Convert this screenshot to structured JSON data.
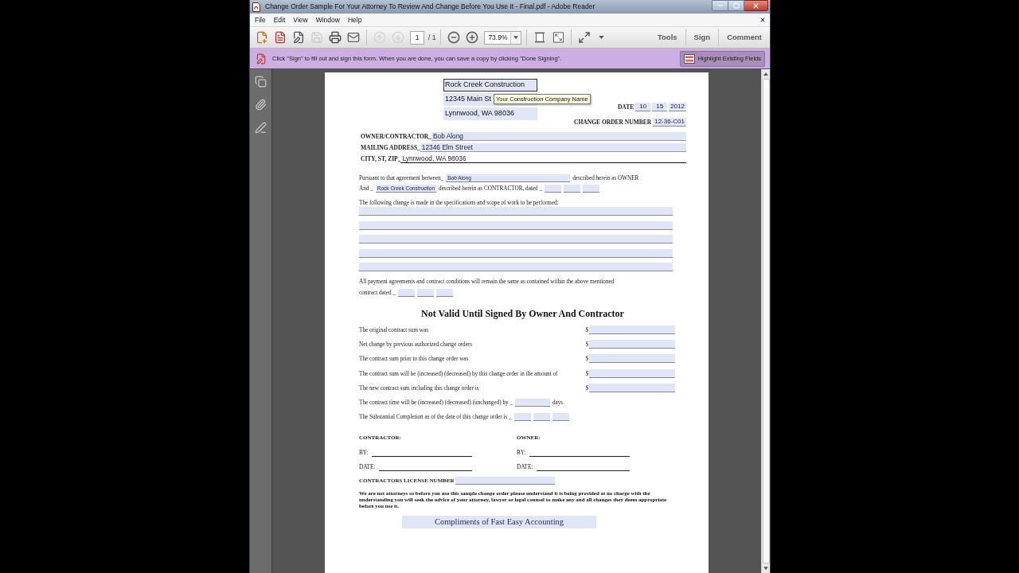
{
  "window": {
    "title": "Change Order Sample For Your Attorney To Review And Change Before You Use It - Final.pdf - Adobe Reader"
  },
  "menu": [
    {
      "label": "File"
    },
    {
      "label": "Edit"
    },
    {
      "label": "View"
    },
    {
      "label": "Window"
    },
    {
      "label": "Help"
    }
  ],
  "toolbar": {
    "file_tools": [
      {
        "kind": "create",
        "disabled": false
      },
      {
        "kind": "convert",
        "disabled": false
      },
      {
        "kind": "edit",
        "disabled": false
      },
      {
        "kind": "save",
        "disabled": true
      },
      {
        "kind": "print",
        "disabled": false
      },
      {
        "kind": "email",
        "disabled": false
      }
    ],
    "page_tools": [
      {
        "kind": "previous",
        "disabled": true
      },
      {
        "kind": "next",
        "disabled": true
      }
    ],
    "page": "1",
    "page_total": "/ 1",
    "zoom_tools": [
      {
        "kind": "zoom_out"
      },
      {
        "kind": "zoom_in"
      }
    ],
    "zoom": "73.9%",
    "view_tools": [
      {
        "kind": "scrolling"
      },
      {
        "kind": "fit"
      }
    ],
    "extra_tools": [
      {
        "kind": "full_screen"
      },
      {
        "kind": "more"
      }
    ],
    "panels": [
      {
        "label": "Tools"
      },
      {
        "label": "Sign"
      },
      {
        "label": "Comment"
      }
    ]
  },
  "message_bar": {
    "text": "Click \"Sign\" to fill out and sign this form. When you are done, you can save a copy by clicking \"Done Signing\".",
    "button": "Highlight Existing Fields"
  },
  "document": {
    "company_fields": [
      {
        "value": "Rock Creek Construction",
        "focused": true
      },
      {
        "value": "12345 Main St",
        "focused": false
      },
      {
        "value": "Lynnwood, WA 98036",
        "focused": false
      }
    ],
    "tooltip": "Your Construction Company Name",
    "date": {
      "label": "DATE",
      "fields": [
        {
          "value": "10"
        },
        {
          "value": "15"
        },
        {
          "value": "2012"
        }
      ]
    },
    "change_order": {
      "label": "CHANGE ORDER NUMBER",
      "value": "12-36-C01"
    },
    "parties": [
      {
        "label": "OWNER/CONTRACTOR_",
        "value": "Bob Along",
        "highlighted": true
      },
      {
        "label": "MAILING ADDRESS_",
        "value": "12346 Elm Street",
        "highlighted": true
      },
      {
        "label": "CITY, ST, ZIP_",
        "value": "Lynnwood, WA 98036",
        "highlighted": false
      }
    ],
    "agreement_lines": [
      {
        "segments": [
          {
            "kind": "text",
            "text": "Pursuant to that agreement between_"
          },
          {
            "kind": "wide_field",
            "value": "Bob Along"
          },
          {
            "kind": "text",
            "text": "described herein as OWNER"
          }
        ]
      },
      {
        "segments": [
          {
            "kind": "text",
            "text": "And _"
          },
          {
            "kind": "field",
            "value": "Rock Creek Construction"
          },
          {
            "kind": "text",
            "text": "described herein as CONTRACTOR, dated _"
          },
          {
            "kind": "date_field"
          },
          {
            "kind": "date_field"
          },
          {
            "kind": "date_field"
          }
        ]
      }
    ],
    "scope": {
      "label": "The following change is made in the specifications and scope of work to be performed:",
      "fields": [
        {
          "kind": "line_field"
        },
        {
          "kind": "line_field"
        },
        {
          "kind": "line_field"
        },
        {
          "kind": "line_field"
        },
        {
          "kind": "line_field"
        }
      ]
    },
    "payment": {
      "text": "All payment agreements and contract conditions will remain the same as contained within the above mentioned",
      "segments": [
        {
          "kind": "text",
          "text": "contract dated _"
        },
        {
          "kind": "date_field"
        },
        {
          "kind": "date_field"
        },
        {
          "kind": "date_field"
        }
      ]
    },
    "heading": "Not Valid Until Signed By Owner And Contractor",
    "sums": [
      {
        "label": "The original contract sum was",
        "prefix": "$"
      },
      {
        "label": "Net change by previous authorized change orders",
        "prefix": "$"
      },
      {
        "label": "The contract sum prior to this change order was",
        "prefix": "$"
      },
      {
        "label": "The contract sum will be (increased) (decreased) by this change order in the amount of",
        "prefix": "$"
      },
      {
        "label": "The new contract sum including this change order is",
        "prefix": "$"
      }
    ],
    "terms": [
      {
        "segments": [
          {
            "kind": "text",
            "text": "The contract time will be (increased) (decreased) (unchanged) by _"
          },
          {
            "kind": "days_field"
          },
          {
            "kind": "text",
            "text": "days"
          }
        ]
      },
      {
        "segments": [
          {
            "kind": "text",
            "text": "The Substantial Completion as of the date of this change order is _"
          },
          {
            "kind": "date_field"
          },
          {
            "kind": "date_field"
          },
          {
            "kind": "date_field"
          }
        ]
      }
    ],
    "signatures": [
      {
        "heading": "CONTRACTOR:",
        "lines": [
          {
            "label": "BY:"
          },
          {
            "label": "DATE:"
          }
        ]
      },
      {
        "heading": "OWNER:",
        "lines": [
          {
            "label": "BY:"
          },
          {
            "label": "DATE:"
          }
        ]
      }
    ],
    "license": {
      "label": "CONTRACTORS LICENSE NUMBER"
    },
    "disclaimer": "We are not attorneys so before you use this sample change order please understand it is being provided at no charge with the understanding you will seek the advice of your attorney, lawyer or legal counsel to make any and all changes they deem appropriate before you use it.",
    "footer": "Compliments of Fast Easy Accounting"
  }
}
